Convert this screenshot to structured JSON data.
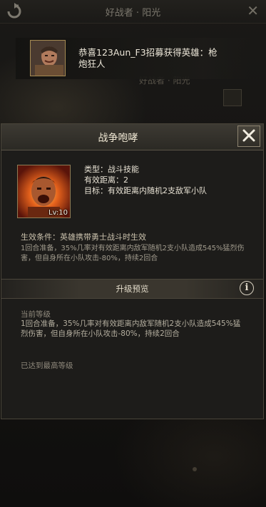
{
  "background": {
    "title": "好战者 · 阳光",
    "sub_title": "好战者 · 阳光"
  },
  "toast": {
    "message": "恭喜123Aun_F3招募获得英雄：枪炮狂人",
    "avatar_icon": "hero-portrait-icon"
  },
  "dialog": {
    "title": "战争咆哮",
    "close_icon": "close-icon",
    "skill": {
      "icon": "skill-war-roar-icon",
      "level": "Lv:10",
      "type": "类型：战斗技能",
      "range": "有效距离：2",
      "target": "目标：有效距离内随机2支敌军小队"
    },
    "condition": "生效条件：英雄携带勇士战斗时生效",
    "description": "1回合准备，35%几率对有效距离内敌军随机2支小队造成545%猛烈伤害，但自身所在小队攻击-80%，持续2回合",
    "upgrade_preview_label": "升级预览",
    "info_icon": "info-icon",
    "current_level_label": "当前等级",
    "current_level_desc": "1回合准备，35%几率对有效距离内敌军随机2支小队造成545%猛烈伤害，但自身所在小队攻击-80%，持续2回合",
    "max_level_text": "已达到最高等级"
  },
  "colors": {
    "accent_gold": "#a58a52",
    "panel_bg": "#1d1c1a"
  }
}
